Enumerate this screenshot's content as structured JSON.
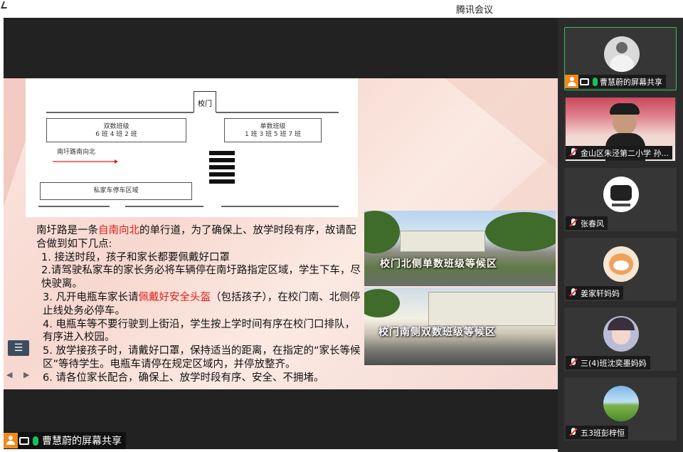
{
  "window": {
    "title": "腾讯会议"
  },
  "slide": {
    "diagram": {
      "gate": "校门",
      "even_classes_title": "双数班级",
      "even_classes_list": "6 班  4 班  2 班",
      "odd_classes_title": "单数班级",
      "odd_classes_list": "1 班  3 班  5 班  7 班",
      "road_direction": "南圩路南向北",
      "parking_area": "私家车停车区域"
    },
    "text": {
      "p1_a": "南圩路是一条",
      "p1_red": "自南向北",
      "p1_b": "的单行道，为了确保上、放学时段有序，故请配合做到如下几点:",
      "item1": "1. 接送时段，孩子和家长都要佩戴好口罩",
      "item2": "2.请驾驶私家车的家长务必将车辆停在南圩路指定区域，学生下车，尽快驶离。",
      "item3_a": "3. 凡开电瓶车家长请",
      "item3_red": "佩戴好安全头盔",
      "item3_b": "（包括孩子），在校门南、北侧停止线处务必停车。",
      "item4": "4. 电瓶车等不要行驶到上街沿，学生按上学时间有序在校门口排队，有序进入校园。",
      "item5": "5. 放学接孩子时，请戴好口罩，保持适当的距离，在指定的“家长等候区”等待学生。电瓶车请停在规定区域内，并停放整齐。",
      "item6": "6. 请各位家长配合，确保上、放学时段有序、安全、不拥堵。"
    },
    "photo1_caption": "校门北侧单数班级等候区",
    "photo2_caption": "校门南侧双数班级等候区"
  },
  "sharer_bar": {
    "name": "曹慧蔚的屏幕共享"
  },
  "participants": [
    {
      "name": "曹慧蔚的屏幕共享",
      "active": true
    },
    {
      "name": "金山区朱泾第二小学 孙..."
    },
    {
      "name": "张春风"
    },
    {
      "name": "姜家轩妈妈"
    },
    {
      "name": "三(4)班沈奕墨妈妈"
    },
    {
      "name": "五3班彭梓恒"
    }
  ],
  "icons": [
    "person-icon",
    "screen-share-icon",
    "mic-icon",
    "mic-muted-icon",
    "list-icon",
    "prev-icon",
    "next-icon"
  ]
}
